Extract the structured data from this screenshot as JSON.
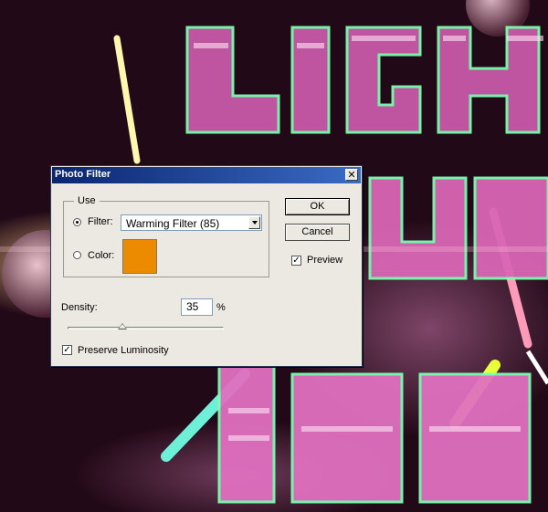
{
  "colors": {
    "swatch": "#ec8a00",
    "titlebar_start": "#0b2570",
    "titlebar_end": "#3a6bc4",
    "dialog_bg": "#ece9e2"
  },
  "background": {
    "description_icon": "neon-lights-artwork",
    "headline_text": "LIGHT"
  },
  "dialog": {
    "title": "Photo Filter",
    "close_glyph": "✕",
    "use_group": {
      "label": "Use",
      "filter_label": "Filter:",
      "filter_selected": true,
      "filter_value": "Warming Filter (85)",
      "color_label": "Color:",
      "color_selected": false
    },
    "buttons": {
      "ok": "OK",
      "cancel": "Cancel"
    },
    "preview": {
      "label": "Preview",
      "checked": true,
      "mark": "✓"
    },
    "density": {
      "label": "Density:",
      "value": "35",
      "unit": "%",
      "slider_fraction": 0.35
    },
    "preserve_luminosity": {
      "label": "Preserve Luminosity",
      "checked": true,
      "mark": "✓"
    }
  }
}
